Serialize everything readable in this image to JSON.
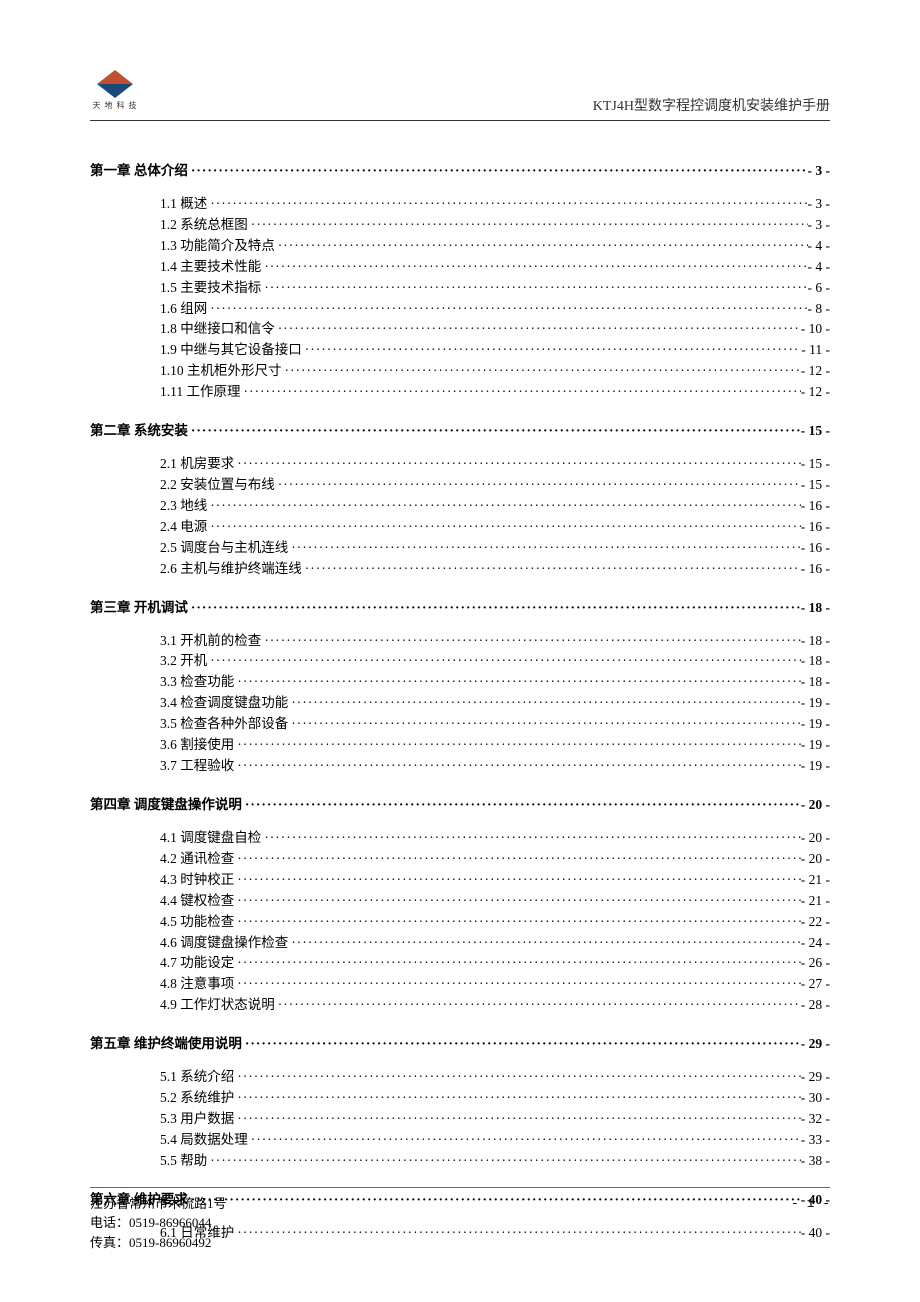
{
  "header": {
    "logo_text": "天 地 科 技",
    "doc_title": "KTJ4H型数字程控调度机安装维护手册"
  },
  "toc": [
    {
      "type": "chapter",
      "label": "第一章  总体介绍",
      "page": "- 3 -"
    },
    {
      "type": "section",
      "label": "1.1 概述",
      "page": "- 3 -"
    },
    {
      "type": "section",
      "label": "1.2 系统总框图",
      "page": "- 3 -"
    },
    {
      "type": "section",
      "label": "1.3 功能简介及特点",
      "page": "- 4 -"
    },
    {
      "type": "section",
      "label": "1.4 主要技术性能",
      "page": "- 4 -"
    },
    {
      "type": "section",
      "label": "1.5 主要技术指标",
      "page": "- 6 -"
    },
    {
      "type": "section",
      "label": "1.6 组网",
      "page": "- 8 -"
    },
    {
      "type": "section",
      "label": "1.8 中继接口和信令",
      "page": "- 10 -"
    },
    {
      "type": "section",
      "label": "1.9 中继与其它设备接口",
      "page": "- 11 -"
    },
    {
      "type": "section",
      "label": "1.10 主机柜外形尺寸",
      "page": "- 12 -"
    },
    {
      "type": "section",
      "label": "1.11 工作原理",
      "page": "- 12 -"
    },
    {
      "type": "chapter",
      "label": "第二章  系统安装",
      "page": "- 15 -"
    },
    {
      "type": "section",
      "label": "2.1 机房要求",
      "page": "- 15 -"
    },
    {
      "type": "section",
      "label": "2.2 安装位置与布线",
      "page": "- 15 -"
    },
    {
      "type": "section",
      "label": "2.3 地线",
      "page": "- 16 -"
    },
    {
      "type": "section",
      "label": "2.4 电源",
      "page": "- 16 -"
    },
    {
      "type": "section",
      "label": "2.5 调度台与主机连线",
      "page": "- 16 -"
    },
    {
      "type": "section",
      "label": "2.6 主机与维护终端连线",
      "page": "- 16 -"
    },
    {
      "type": "chapter",
      "label": "第三章  开机调试",
      "page": "- 18 -"
    },
    {
      "type": "section",
      "label": "3.1 开机前的检查",
      "page": "- 18 -"
    },
    {
      "type": "section",
      "label": "3.2 开机",
      "page": "- 18 -"
    },
    {
      "type": "section",
      "label": "3.3 检查功能",
      "page": "- 18 -"
    },
    {
      "type": "section",
      "label": "3.4 检查调度键盘功能",
      "page": "- 19 -"
    },
    {
      "type": "section",
      "label": "3.5 检查各种外部设备",
      "page": "- 19 -"
    },
    {
      "type": "section",
      "label": "3.6 割接使用",
      "page": "- 19 -"
    },
    {
      "type": "section",
      "label": "3.7 工程验收",
      "page": "- 19 -"
    },
    {
      "type": "chapter",
      "label": "第四章  调度键盘操作说明",
      "page": "- 20 -"
    },
    {
      "type": "section",
      "label": "4.1 调度键盘自检",
      "page": "- 20 -"
    },
    {
      "type": "section",
      "label": "4.2 通讯检查",
      "page": "- 20 -"
    },
    {
      "type": "section",
      "label": "4.3 时钟校正",
      "page": "- 21 -"
    },
    {
      "type": "section",
      "label": "4.4 键权检查",
      "page": "- 21 -"
    },
    {
      "type": "section",
      "label": "4.5 功能检查",
      "page": "- 22 -"
    },
    {
      "type": "section",
      "label": "4.6 调度键盘操作检查",
      "page": "- 24 -"
    },
    {
      "type": "section",
      "label": "4.7 功能设定",
      "page": "- 26 -"
    },
    {
      "type": "section",
      "label": "4.8 注意事项",
      "page": "- 27 -"
    },
    {
      "type": "section",
      "label": "4.9 工作灯状态说明",
      "page": "- 28 -"
    },
    {
      "type": "chapter",
      "label": "第五章  维护终端使用说明",
      "page": "- 29 -"
    },
    {
      "type": "section",
      "label": "5.1 系统介绍",
      "page": "- 29 -"
    },
    {
      "type": "section",
      "label": "5.2 系统维护",
      "page": "- 30 -"
    },
    {
      "type": "section",
      "label": "5.3 用户数据",
      "page": "- 32 -"
    },
    {
      "type": "section",
      "label": "5.4 局数据处理",
      "page": "- 33 -"
    },
    {
      "type": "section",
      "label": "5.5 帮助",
      "page": "- 38 -"
    },
    {
      "type": "chapter",
      "label": "第六章  维护要求",
      "page": "- 40 -"
    },
    {
      "type": "section",
      "label": "6.1 日常维护",
      "page": "- 40 -"
    }
  ],
  "footer": {
    "address": "江苏省常州市木梳路1号",
    "phone": "电话：0519-86966044",
    "fax": "传真：0519-86960492",
    "page_num": "- 1 -"
  },
  "dots": "···························································································································································································"
}
